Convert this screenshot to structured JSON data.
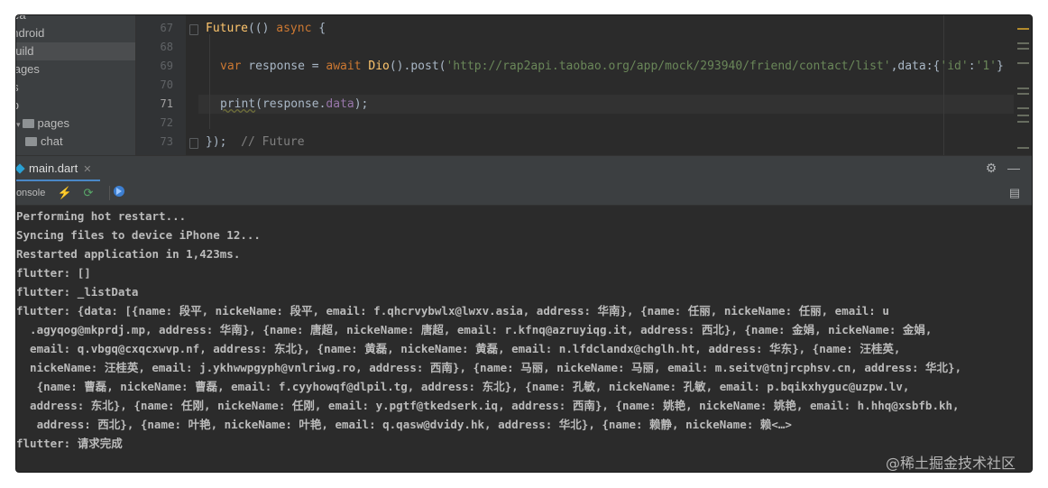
{
  "project_tree": {
    "items": [
      {
        "label": "idea",
        "type": "folder"
      },
      {
        "label": "android",
        "type": "folder"
      },
      {
        "label": "build",
        "type": "folder"
      },
      {
        "label": "images",
        "type": "folder"
      },
      {
        "label": "ios",
        "type": "folder"
      },
      {
        "label": "lib",
        "type": "folder"
      },
      {
        "label": "pages",
        "type": "folder"
      },
      {
        "label": "chat",
        "type": "folder"
      }
    ]
  },
  "editor": {
    "line_numbers": [
      "67",
      "68",
      "69",
      "70",
      "71",
      "72",
      "73"
    ],
    "current_line": "71",
    "lines": {
      "l67": {
        "fn": "Future",
        "punct": "(() ",
        "kw": "async",
        "rest": " {"
      },
      "l69": {
        "kw_var": "var",
        "id": " response = ",
        "kw_await": "await",
        "sp": " ",
        "fn_dio": "Dio",
        "mid": "().post(",
        "url": "'http://rap2api.taobao.org/app/mock/293940/friend/contact/list'",
        "after": ",data:{",
        "k": "'id'",
        "colon": ":",
        "v": "'1'",
        "end": "}"
      },
      "l71": {
        "fn": "print",
        "open": "(response.",
        "field": "data",
        "close": ");"
      },
      "l73": {
        "code": "});",
        "comment": "  // Future"
      }
    }
  },
  "tool_window": {
    "tab_label": "main.dart",
    "console_label": "Console",
    "icons": {
      "settings": "gear-icon",
      "minimize": "minimize-icon",
      "hot_reload": "lightning-icon",
      "hot_restart": "restart-icon",
      "devtools": "devtools-icon",
      "layout": "layout-icon"
    }
  },
  "console": {
    "lines": [
      "Performing hot restart...",
      "Syncing files to device iPhone 12...",
      "Restarted application in 1,423ms.",
      "flutter: []",
      "flutter: _listData",
      "flutter: {data: [{name: 段平, nickeName: 段平, email: f.qhcrvybwlx@lwxv.asia, address: 华南}, {name: 任丽, nickeName: 任丽, email: u",
      "  .agyqog@mkprdj.mp, address: 华南}, {name: 唐超, nickeName: 唐超, email: r.kfnq@azruyiqg.it, address: 西北}, {name: 金娟, nickeName: 金娟,",
      "  email: q.vbgq@cxqcxwvp.nf, address: 东北}, {name: 黄磊, nickeName: 黄磊, email: n.lfdclandx@chglh.ht, address: 华东}, {name: 汪桂英,",
      "  nickeName: 汪桂英, email: j.ykhwwpgyph@vnlriwg.ro, address: 西南}, {name: 马丽, nickeName: 马丽, email: m.seitv@tnjrcphsv.cn, address: 华北},",
      "   {name: 曹磊, nickeName: 曹磊, email: f.cyyhowqf@dlpil.tg, address: 东北}, {name: 孔敏, nickeName: 孔敏, email: p.bqikxhyguc@uzpw.lv,",
      "  address: 东北}, {name: 任刚, nickeName: 任刚, email: y.pgtf@tkedserk.iq, address: 西南}, {name: 姚艳, nickeName: 姚艳, email: h.hhq@xsbfb.kh,",
      "   address: 西北}, {name: 叶艳, nickeName: 叶艳, email: q.qasw@dvidy.hk, address: 华北}, {name: 赖静, nickeName: 赖<…>",
      "flutter: 请求完成"
    ]
  },
  "watermark": "@稀土掘金技术社区",
  "colors": {
    "background": "#2b2b2b",
    "keyword": "#cc7832",
    "function": "#ffc66d",
    "string": "#6a8759",
    "field": "#9876aa",
    "comment": "#808080"
  }
}
